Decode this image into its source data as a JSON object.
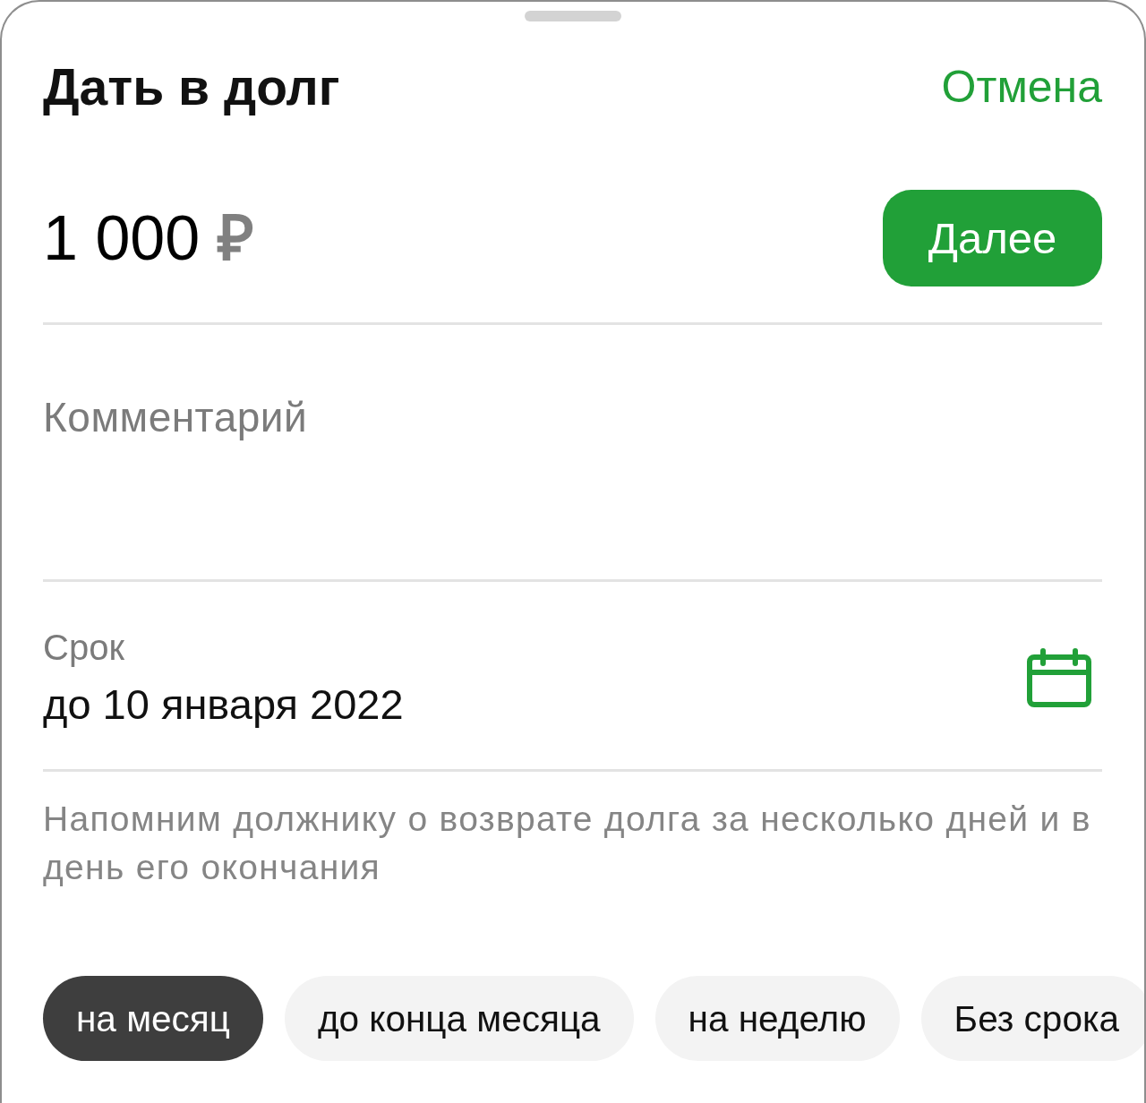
{
  "header": {
    "title": "Дать в долг",
    "cancel": "Отмена"
  },
  "amount": {
    "value": "1 000",
    "currency": "₽"
  },
  "next_button": {
    "label": "Далее"
  },
  "comment": {
    "placeholder": "Комментарий"
  },
  "term": {
    "label": "Срок",
    "value": "до 10 января 2022"
  },
  "hint": "Напомним должнику о возврате долга за несколько дней и в день его окончания",
  "chips": [
    {
      "label": "на месяц",
      "selected": true
    },
    {
      "label": "до конца месяца",
      "selected": false
    },
    {
      "label": "на неделю",
      "selected": false
    },
    {
      "label": "Без срока",
      "selected": false
    }
  ]
}
